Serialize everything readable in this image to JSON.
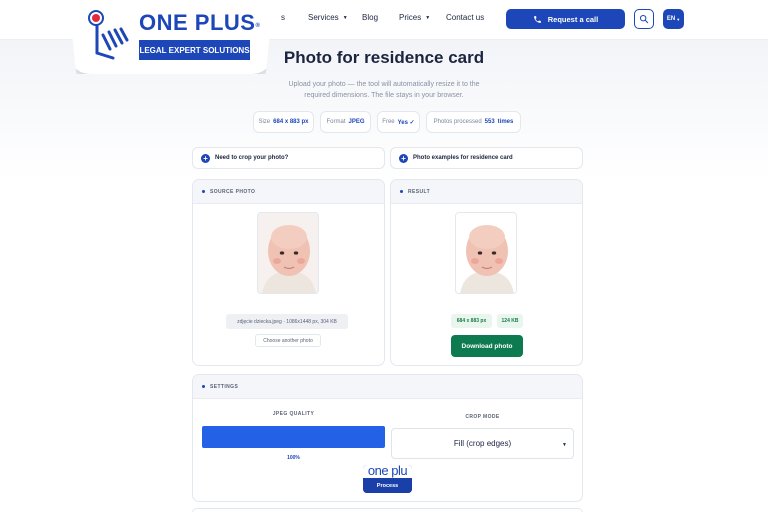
{
  "header": {
    "nav": [
      {
        "label": "s",
        "dropdown": false
      },
      {
        "label": "Services",
        "dropdown": true
      },
      {
        "label": "Blog",
        "dropdown": false
      },
      {
        "label": "Prices",
        "dropdown": true
      },
      {
        "label": "Contact us",
        "dropdown": false
      }
    ],
    "call_label": "Request a call",
    "lang_label": "EN"
  },
  "logo": {
    "name": "ONE PLUS",
    "reg": "®",
    "tagline": "LEGAL EXPERT SOLUTIONS"
  },
  "hero": {
    "title": "Photo for residence card",
    "subtitle": "Upload your photo — the tool will automatically resize it to the required dimensions. The file stays in your browser."
  },
  "stats": {
    "size_label": "Size",
    "size_value": "684 x 883 px",
    "format_label": "Format",
    "format_value": "JPEG",
    "free_label": "Free",
    "free_value": "Yes ✓",
    "processed_label": "Photos processed",
    "processed_value": "553",
    "processed_unit": "times"
  },
  "accordions": {
    "crop": "Need to crop your photo?",
    "examples": "Photo examples for residence card"
  },
  "source_panel": {
    "title": "SOURCE PHOTO",
    "file_info": "zdjęcie dziecka.jpeg · 1086x1448 px, 304 KB",
    "choose_label": "Choose another photo"
  },
  "result_panel": {
    "title": "RESULT",
    "dimensions": "684 x 883 px",
    "file_size": "124 KB",
    "download_label": "Download photo"
  },
  "settings": {
    "title": "SETTINGS",
    "quality_label": "JPEG QUALITY",
    "quality_value": "100%",
    "quality_fraction": 1.0,
    "crop_label": "CROP MODE",
    "crop_value": "Fill (crop edges)",
    "process_ghost": "one plu",
    "process_label": "Process"
  },
  "colors": {
    "brand": "#1d47b8",
    "success": "#0d7a4f",
    "slider": "#2362e6"
  }
}
